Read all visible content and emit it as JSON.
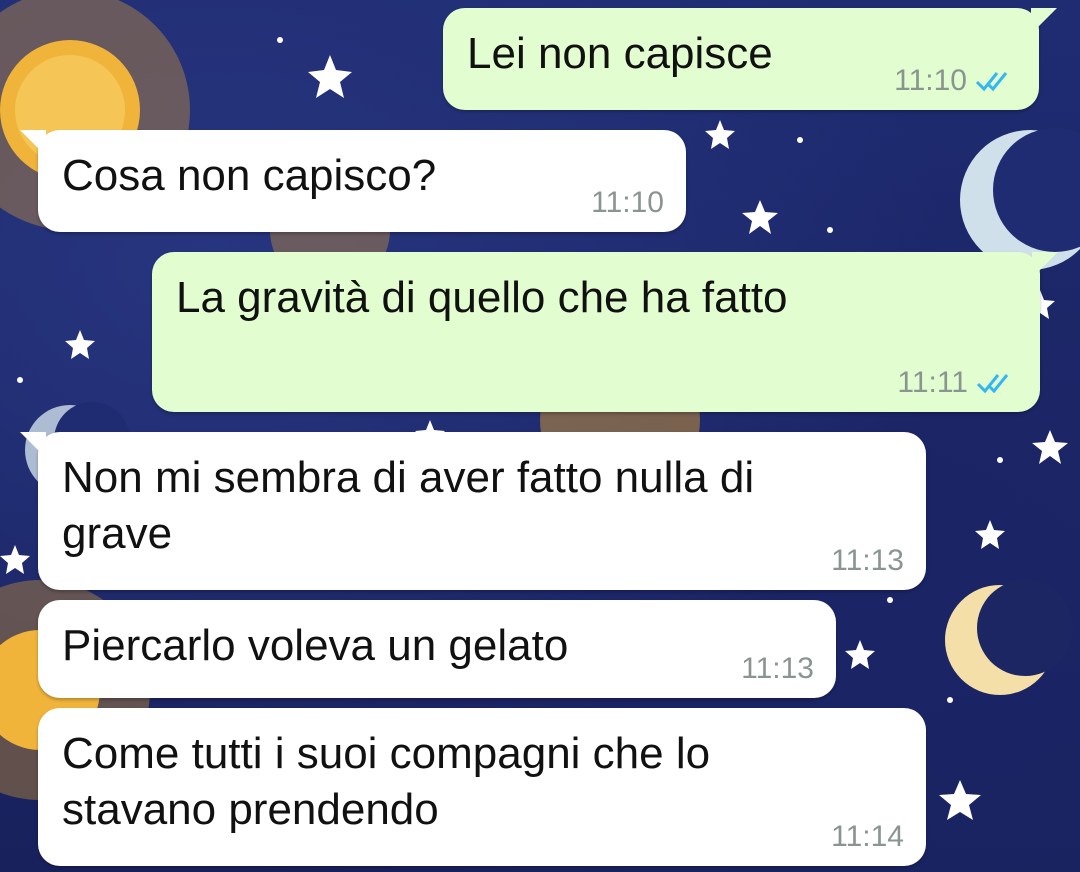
{
  "colors": {
    "outgoing_bubble": "#e2fdd0",
    "incoming_bubble": "#ffffff",
    "read_receipt": "#34b7f1",
    "timestamp": "#8a9590"
  },
  "messages": [
    {
      "direction": "outgoing",
      "text": "Lei non capisce",
      "time": "11:10",
      "status_icon": "double-check-read-icon"
    },
    {
      "direction": "incoming",
      "text": "Cosa non capisco?",
      "time": "11:10"
    },
    {
      "direction": "outgoing",
      "text": "La gravità di quello che ha fatto",
      "time": "11:11",
      "status_icon": "double-check-read-icon"
    },
    {
      "direction": "incoming",
      "text": "Non mi sembra di aver fatto nulla di\ngrave",
      "time": "11:13"
    },
    {
      "direction": "incoming",
      "text": "Piercarlo voleva un gelato",
      "time": "11:13"
    },
    {
      "direction": "incoming",
      "text": "Come tutti i suoi compagni che lo\nstavano prendendo",
      "time": "11:14"
    }
  ]
}
